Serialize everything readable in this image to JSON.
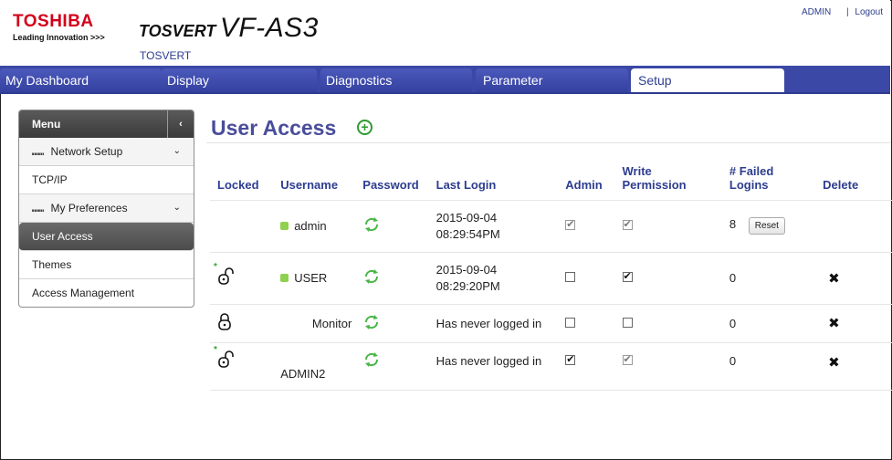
{
  "header": {
    "logo_name": "TOSHIBA",
    "logo_tagline": "Leading Innovation >>>",
    "product_brand": "TOSVERT",
    "product_model": "VF-AS3",
    "product_sub": "TOSVERT",
    "admin_link": "ADMIN",
    "separator": "|",
    "logout_link": "Logout"
  },
  "nav": {
    "tabs": [
      {
        "label": "My Dashboard"
      },
      {
        "label": "Display"
      },
      {
        "label": "Diagnostics"
      },
      {
        "label": "Parameter"
      },
      {
        "label": "Setup",
        "active": true
      }
    ]
  },
  "sidebar": {
    "title": "Menu",
    "collapse_glyph": "‹",
    "groups": [
      {
        "label": "Network Setup",
        "items": [
          "TCP/IP"
        ]
      },
      {
        "label": "My Preferences",
        "items": [
          "User Access",
          "Themes",
          "Access Management"
        ]
      }
    ],
    "active_item": "User Access"
  },
  "main": {
    "title": "User Access",
    "columns": [
      "Locked",
      "Username",
      "Password",
      "Last Login",
      "Admin",
      "Write Permission",
      "# Failed Logins",
      "Delete"
    ],
    "write_permission_header": [
      "Write",
      "Permission"
    ],
    "failed_logins_header": [
      "# Failed",
      "Logins"
    ],
    "reset_label": "Reset",
    "delete_glyph": "✖",
    "rows": [
      {
        "locked": "",
        "username": "admin",
        "online": true,
        "last_login": [
          "2015-09-04",
          "08:29:54PM"
        ],
        "admin": true,
        "admin_dim": true,
        "write": true,
        "write_dim": true,
        "failed": "8",
        "reset": true,
        "delete": false
      },
      {
        "locked": "unlocked-new",
        "username": "USER",
        "online": true,
        "last_login": [
          "2015-09-04",
          "08:29:20PM"
        ],
        "admin": false,
        "admin_dim": false,
        "write": true,
        "write_dim": false,
        "failed": "0",
        "reset": false,
        "delete": true
      },
      {
        "locked": "locked",
        "username": "Monitor",
        "online": false,
        "last_login": [
          "Has never logged in"
        ],
        "admin": false,
        "admin_dim": false,
        "write": false,
        "write_dim": false,
        "failed": "0",
        "reset": false,
        "delete": true
      },
      {
        "locked": "unlocked-new",
        "username": "ADMIN2",
        "online": false,
        "last_login": [
          "Has never logged in"
        ],
        "admin": true,
        "admin_dim": false,
        "write": true,
        "write_dim": true,
        "failed": "0",
        "reset": false,
        "delete": true
      }
    ]
  },
  "colors": {
    "brand_red": "#d2001a",
    "nav_blue": "#3b48a6",
    "title_purple": "#4a4d9a",
    "online_green": "#8fd14f",
    "add_green": "#2e9b32"
  }
}
